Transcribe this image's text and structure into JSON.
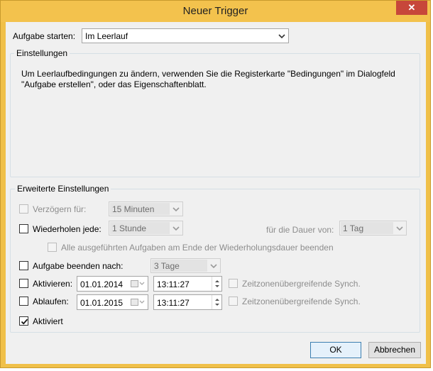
{
  "window": {
    "title": "Neuer Trigger",
    "close_label": "✕"
  },
  "start": {
    "label": "Aufgabe starten:",
    "value": "Im Leerlauf"
  },
  "settings": {
    "title": "Einstellungen",
    "text_line1": "Um Leerlaufbedingungen zu ändern, verwenden Sie die Registerkarte \"Bedingungen\" im Dialogfeld",
    "text_line2": "\"Aufgabe erstellen\", oder das Eigenschaftenblatt."
  },
  "advanced": {
    "title": "Erweiterte Einstellungen",
    "delay": {
      "label": "Verzögern für:",
      "value": "15 Minuten",
      "checked": false,
      "enabled": false
    },
    "repeat": {
      "label": "Wiederholen jede:",
      "value": "1 Stunde",
      "checked": false,
      "duration_label": "für die Dauer von:",
      "duration_value": "1 Tag"
    },
    "stop_all": {
      "label": "Alle ausgeführten Aufgaben am Ende der Wiederholungsdauer beenden",
      "checked": false,
      "enabled": false
    },
    "stop_after": {
      "label": "Aufgabe beenden nach:",
      "value": "3 Tage",
      "checked": false
    },
    "activate": {
      "label": "Aktivieren:",
      "date": "01.01.2014",
      "time": "13:11:27",
      "sync_label": "Zeitzonenübergreifende Synch.",
      "checked": false
    },
    "expire": {
      "label": "Ablaufen:",
      "date": "01.01.2015",
      "time": "13:11:27",
      "sync_label": "Zeitzonenübergreifende Synch.",
      "checked": false
    },
    "enabled": {
      "label": "Aktiviert",
      "checked": true
    }
  },
  "buttons": {
    "ok": "OK",
    "cancel": "Abbrechen"
  }
}
